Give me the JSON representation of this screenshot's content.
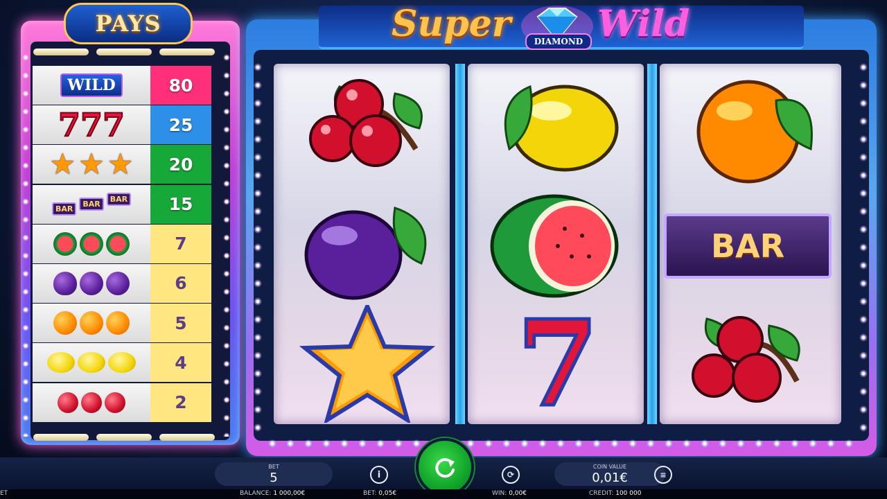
{
  "paytable": {
    "title": "PAYS",
    "rows": [
      {
        "symbol": "diamond-wild",
        "symbol_text": "WILD",
        "payout": "80",
        "color": "#ff2f7a"
      },
      {
        "symbol": "seven",
        "symbol_text": "777",
        "payout": "25",
        "color": "#2d8fe8"
      },
      {
        "symbol": "star",
        "payout": "20",
        "color": "#17a83a"
      },
      {
        "symbol": "bar",
        "symbol_text": "BAR",
        "payout": "15",
        "color": "#17a83a"
      },
      {
        "symbol": "watermelon",
        "payout": "7",
        "color": "#ffe680"
      },
      {
        "symbol": "plum",
        "payout": "6",
        "color": "#ffe680"
      },
      {
        "symbol": "orange",
        "payout": "5",
        "color": "#ffe680"
      },
      {
        "symbol": "lemon",
        "payout": "4",
        "color": "#ffe680"
      },
      {
        "symbol": "cherry",
        "payout": "2",
        "color": "#ffe680"
      }
    ]
  },
  "logo": {
    "word1": "Super",
    "badge": "DIAMOND",
    "word2": "Wild"
  },
  "reels": [
    [
      "cherry",
      "plum",
      "star"
    ],
    [
      "lemon",
      "watermelon",
      "seven"
    ],
    [
      "orange",
      "bar",
      "cherry"
    ]
  ],
  "reel_text": {
    "bar": "BAR",
    "seven": "7"
  },
  "controls": {
    "bet_label": "BET",
    "bet_value": "5",
    "coin_label": "COIN VALUE",
    "coin_value": "0,01€",
    "info_icon": "info-icon",
    "autoplay_icon": "autoplay-icon",
    "spin_icon": "spin-icon",
    "coins_icon": "coins-icon"
  },
  "status": {
    "left_cut": "ET",
    "balance_label": "BALANCE:",
    "balance_value": "1 000,00€",
    "bet_label": "BET:",
    "bet_value": "0,05€",
    "win_label": "WIN:",
    "win_value": "0,00€",
    "credit_label": "CREDIT:",
    "credit_value": "100 000"
  }
}
